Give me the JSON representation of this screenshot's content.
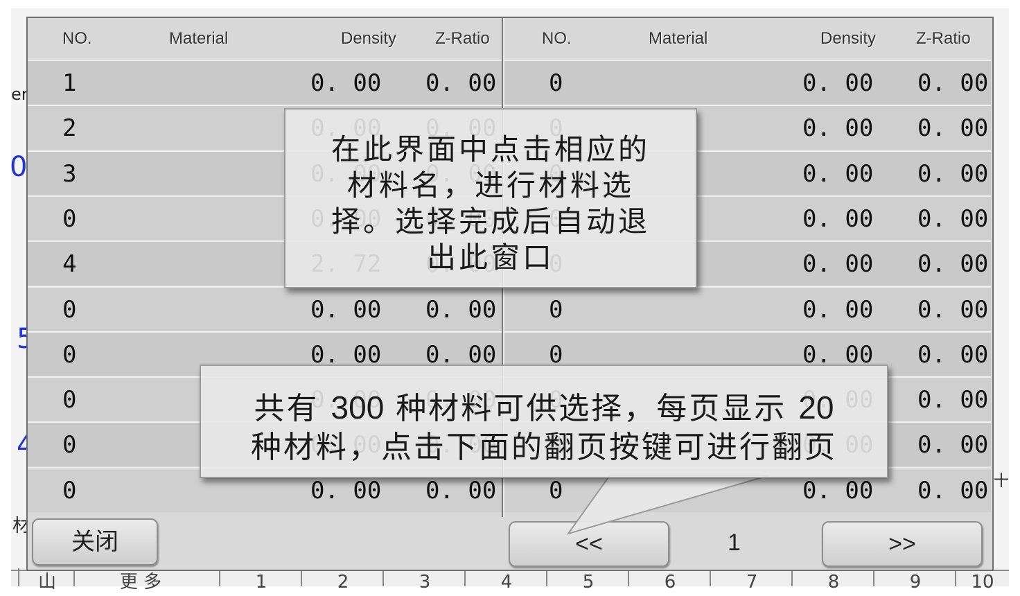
{
  "background": {
    "edge_texts": [
      "er",
      "0",
      "5",
      "4",
      "材",
      "十"
    ],
    "bottom_strip": [
      "山",
      "更 多",
      "1",
      "2",
      "3",
      "4",
      "5",
      "6",
      "7",
      "8",
      "9",
      "10"
    ]
  },
  "headers": [
    "NO.",
    "Material",
    "Density",
    "Z-Ratio",
    "NO.",
    "Material",
    "Density",
    "Z-Ratio"
  ],
  "rows_left": [
    {
      "no": "1",
      "density": "0. 00",
      "zratio": "0. 00"
    },
    {
      "no": "2",
      "density": "0. 00",
      "zratio": "0. 00"
    },
    {
      "no": "3",
      "density": "0. 00",
      "zratio": "0. 00"
    },
    {
      "no": "0",
      "density": "0. 00",
      "zratio": "0. 00"
    },
    {
      "no": "4",
      "density": "2. 72",
      "zratio": "0. 00"
    },
    {
      "no": "0",
      "density": "0. 00",
      "zratio": "0. 00"
    },
    {
      "no": "0",
      "density": "0. 00",
      "zratio": "0. 00"
    },
    {
      "no": "0",
      "density": "0. 00",
      "zratio": "0. 00"
    },
    {
      "no": "0",
      "density": "0. 00",
      "zratio": "0. 00"
    },
    {
      "no": "0",
      "density": "0. 00",
      "zratio": "0. 00"
    }
  ],
  "rows_right": [
    {
      "no": "0",
      "density": "0. 00",
      "zratio": "0. 00"
    },
    {
      "no": "0",
      "density": "0. 00",
      "zratio": "0. 00"
    },
    {
      "no": "0",
      "density": "0. 00",
      "zratio": "0. 00"
    },
    {
      "no": "0",
      "density": "0. 00",
      "zratio": "0. 00"
    },
    {
      "no": "0",
      "density": "0. 00",
      "zratio": "0. 00"
    },
    {
      "no": "0",
      "density": "0. 00",
      "zratio": "0. 00"
    },
    {
      "no": "0",
      "density": "0. 00",
      "zratio": "0. 00"
    },
    {
      "no": "0",
      "density": "0. 00",
      "zratio": "0. 00"
    },
    {
      "no": "0",
      "density": "0. 00",
      "zratio": "0. 00"
    },
    {
      "no": "0",
      "density": "0. 00",
      "zratio": "0. 00"
    }
  ],
  "buttons": {
    "close": "关闭",
    "prev": "<<",
    "next": ">>"
  },
  "page_number": "1",
  "callout_top": {
    "lines": [
      "在此界面中点击相应的",
      "材料名，进行材料选",
      "择。选择完成后自动退",
      "出此窗口"
    ]
  },
  "callout_bottom": {
    "line1_a": "共有",
    "line1_num1": "300",
    "line1_b": "种材料可供选择，每页显示",
    "line1_num2": "20",
    "line2": "种材料，点击下面的翻页按键可进行翻页"
  }
}
